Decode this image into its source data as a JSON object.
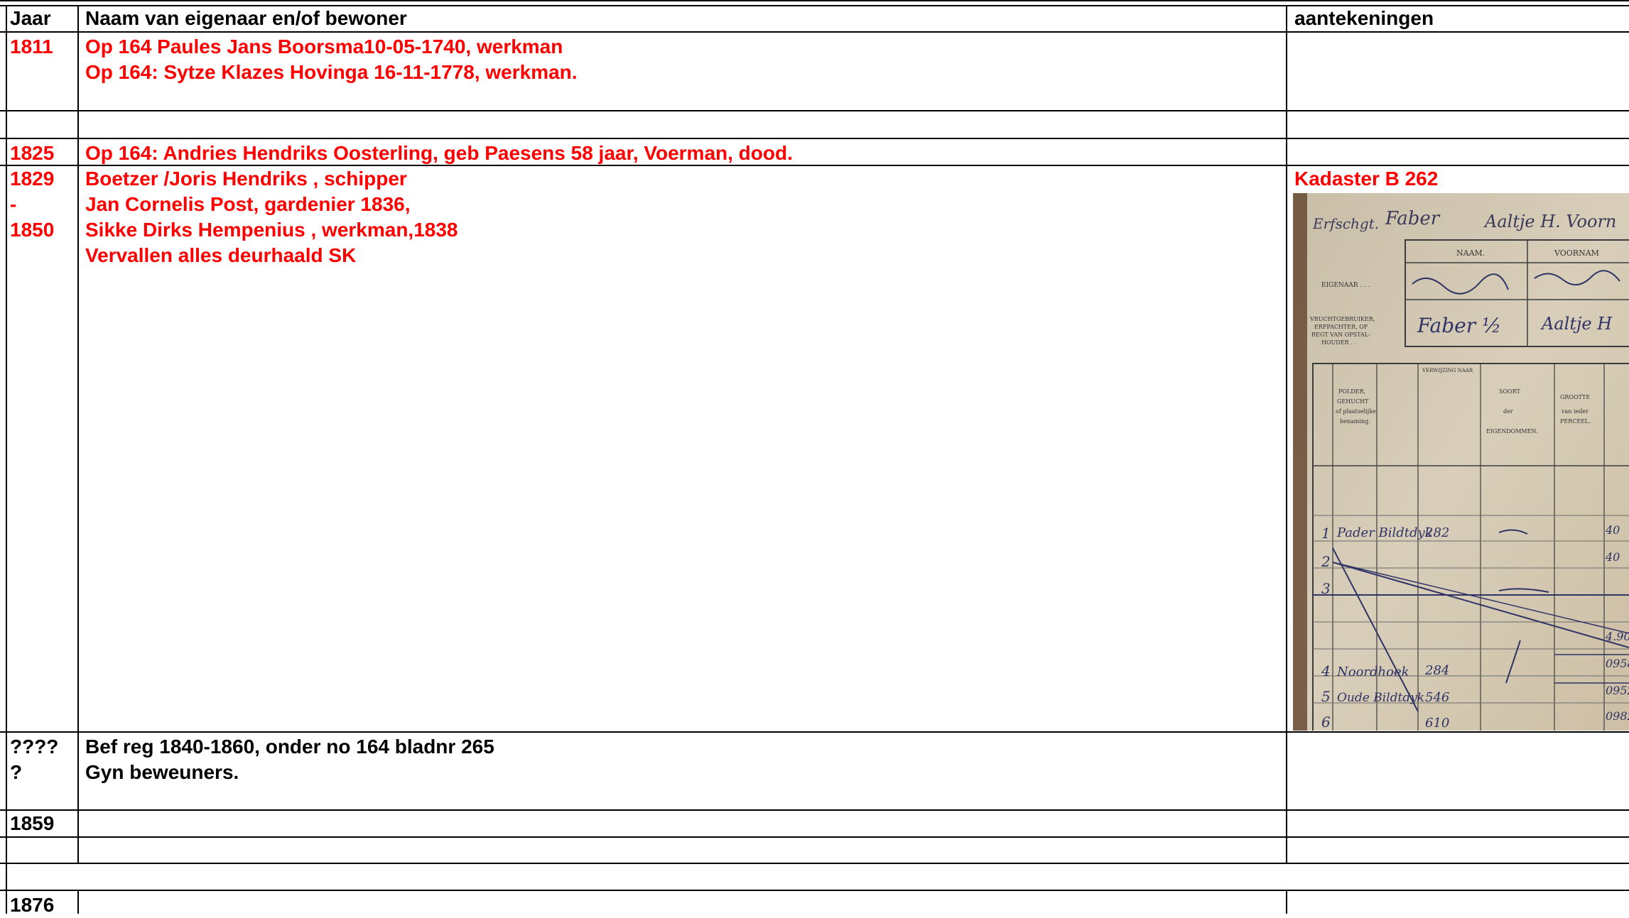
{
  "colors": {
    "accent_red": "#ff0000",
    "text": "#000000",
    "grid": "#000000"
  },
  "table": {
    "headers": {
      "jaar": "Jaar",
      "naam": "Naam van eigenaar en/of bewoner",
      "aantekeningen": "aantekeningen"
    },
    "r1811": {
      "jaar": "1811",
      "line1": "Op 164 Paules Jans Boorsma10-05-1740, werkman",
      "line2": "Op 164: Sytze Klazes Hovinga 16-11-1778, werkman."
    },
    "r1825": {
      "jaar": "1825",
      "line1": "Op 164: Andries Hendriks Oosterling, geb Paesens 58 jaar, Voerman, dood."
    },
    "r1829": {
      "jaar1": "1829",
      "jaar2": "-",
      "jaar3": "1850",
      "line1": "Boetzer /Joris Hendriks , schipper",
      "line2": "Jan Cornelis Post, gardenier 1836,",
      "line3": "Sikke Dirks Hempenius , werkman,1838",
      "line4": "Vervallen alles deurhaald SK",
      "note": "Kadaster B 262"
    },
    "rq": {
      "jaar1": "????",
      "jaar2": "?",
      "line1": "Bef reg 1840-1860, onder no 164  bladnr 265",
      "line2": "Gyn beweuners."
    },
    "r1859": {
      "jaar": "1859"
    },
    "r1876": {
      "jaar": "1876"
    }
  },
  "scan": {
    "header_naam": "NAAM.",
    "header_voornaam": "VOORNAM",
    "label_eigenaar": "EIGENAAR . . .",
    "label_vruchtgebruiker": "VRUCHTGEBRUIKER, ERFPACHTER, OF REGT VAN OPSTAL-HOUDER . .",
    "col_polder": "POLDER, GEHUCHT of plaatselijke benaming.",
    "col_soort": "SOORT der EIGENDOMMEN.",
    "col_grootte": "GROOTTE van ieder PERCEEL.",
    "col_verwijzing": "VERWIJZING NAAR",
    "hw_top": "Faber",
    "hw_top2": "Aaltje H. Voorn",
    "hw_1": "Pader Bildtdyk",
    "hw_4": "Noordhoek",
    "hw_5": "Oude Bildtdyk",
    "n_282": "282",
    "n_284": "284",
    "n_546": "546",
    "n_610": "610"
  }
}
